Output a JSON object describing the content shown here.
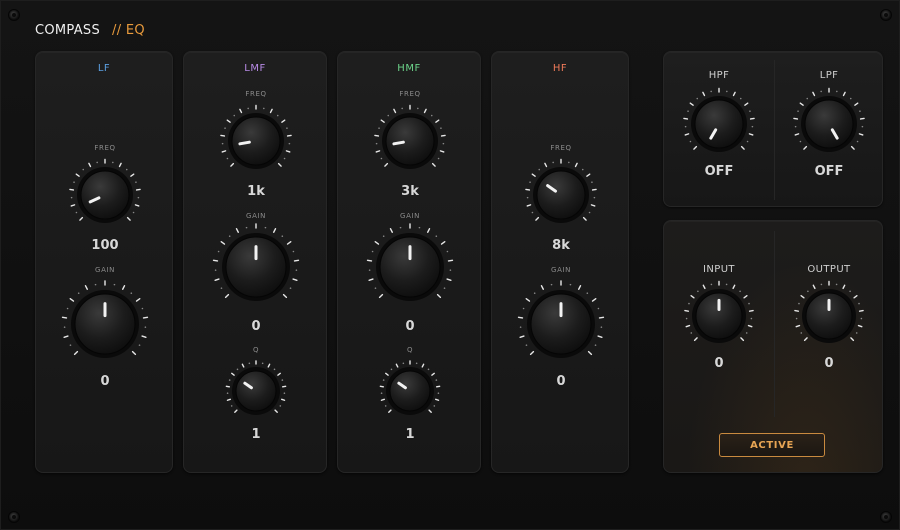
{
  "brand": {
    "name": "COMPASS",
    "sub": "// EQ"
  },
  "colors": {
    "lf": "#5b9fe0",
    "lmf": "#b88be6",
    "hmf": "#6cd48a",
    "hf": "#ef7a5a",
    "accent": "#e89a3c"
  },
  "bands": {
    "lf": {
      "title": "LF",
      "freq_label": "FREQ",
      "freq_value": "100",
      "gain_label": "GAIN",
      "gain_value": "0"
    },
    "lmf": {
      "title": "LMF",
      "freq_label": "FREQ",
      "freq_value": "1k",
      "gain_label": "GAIN",
      "gain_value": "0",
      "q_label": "Q",
      "q_value": "1"
    },
    "hmf": {
      "title": "HMF",
      "freq_label": "FREQ",
      "freq_value": "3k",
      "gain_label": "GAIN",
      "gain_value": "0",
      "q_label": "Q",
      "q_value": "1"
    },
    "hf": {
      "title": "HF",
      "freq_label": "FREQ",
      "freq_value": "8k",
      "gain_label": "GAIN",
      "gain_value": "0"
    }
  },
  "filters": {
    "hpf": {
      "label": "HPF",
      "value": "OFF"
    },
    "lpf": {
      "label": "LPF",
      "value": "OFF"
    }
  },
  "io": {
    "input": {
      "label": "INPUT",
      "value": "0"
    },
    "output": {
      "label": "OUTPUT",
      "value": "0"
    },
    "active_label": "ACTIVE"
  },
  "knob_angles": {
    "lf_freq": -115,
    "lf_gain": 0,
    "lmf_freq": -100,
    "lmf_gain": 0,
    "lmf_q": -55,
    "hmf_freq": -100,
    "hmf_gain": 0,
    "hmf_q": -55,
    "hf_freq": -55,
    "hf_gain": 0,
    "hpf": -150,
    "lpf": 150,
    "input": 0,
    "output": 0
  }
}
